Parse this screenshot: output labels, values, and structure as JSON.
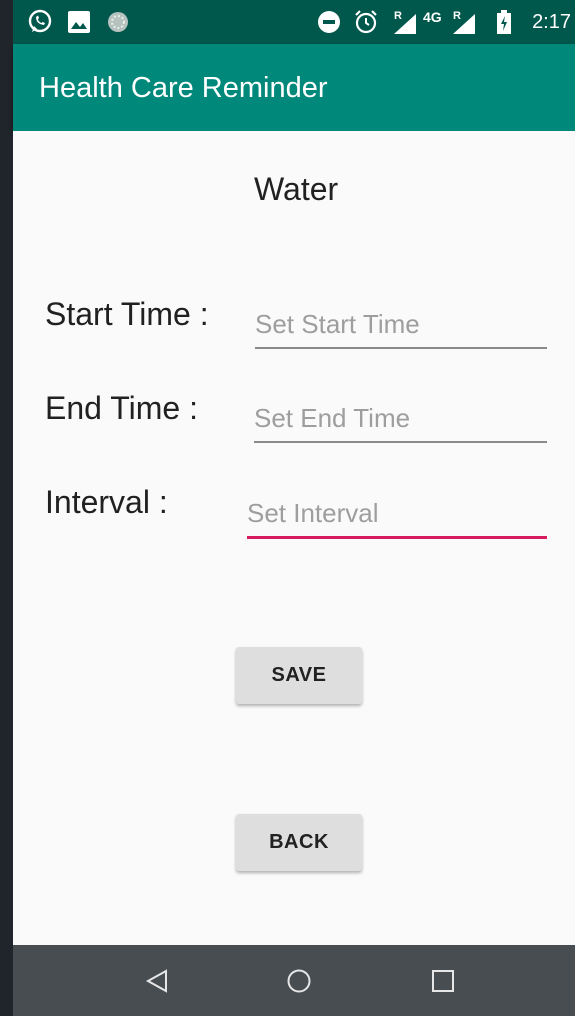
{
  "status_bar": {
    "time": "2:17",
    "network": "4G",
    "roaming_1": "R",
    "roaming_2": "R",
    "icons": [
      "whatsapp-icon",
      "image-icon",
      "loading-icon",
      "do-not-disturb-icon",
      "alarm-icon",
      "signal-icon",
      "signal-icon",
      "battery-icon"
    ]
  },
  "app_bar": {
    "title": "Health Care Reminder",
    "color": "#00897b"
  },
  "screen": {
    "heading": "Water",
    "start_time": {
      "label": "Start Time :",
      "placeholder": "Set Start Time"
    },
    "end_time": {
      "label": "End Time :",
      "placeholder": "Set End Time"
    },
    "interval": {
      "label": "Interval :",
      "placeholder": "Set Interval"
    },
    "save_label": "SAVE",
    "back_label": "BACK",
    "accent_color": "#d81b60"
  },
  "nav_bar": {
    "icons": [
      "back-icon",
      "home-icon",
      "recents-icon"
    ]
  }
}
